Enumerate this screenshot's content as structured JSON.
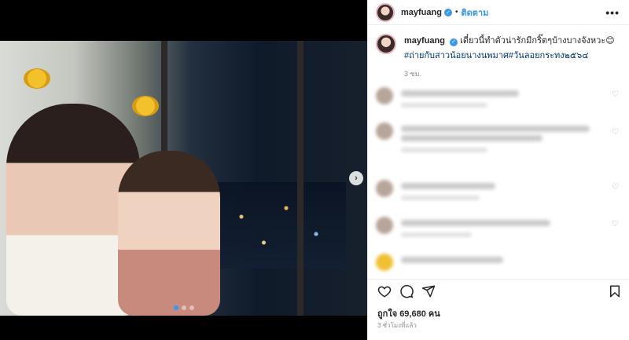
{
  "header": {
    "username": "mayfuang",
    "separator": "•",
    "follow_label": "ติดตาม",
    "more_label": "•••"
  },
  "caption": {
    "username": "mayfuang",
    "text": "เดี๋ยวนี้ทำตัวน่ารักมีกริ๊ตๆบ้างบางจังหวะ😊",
    "hashtags": "#ถ่ายกับสาวน้อยนางนพมาศ#วันลอยกระทง๒๕๖๔",
    "time": "3 ชม."
  },
  "media": {
    "next_arrow": "›",
    "slides": 3,
    "active_slide": 1
  },
  "icons": {
    "like": "heart-icon",
    "comment": "comment-icon",
    "share": "share-icon",
    "save": "bookmark-icon"
  },
  "likes": {
    "text": "ถูกใจ 69,680 คน"
  },
  "footer": {
    "ago": "3 ชั่วโมงที่แล้ว"
  },
  "colors": {
    "accent": "#3897f0",
    "hashtag": "#00376b",
    "muted": "#8e8e8e"
  }
}
